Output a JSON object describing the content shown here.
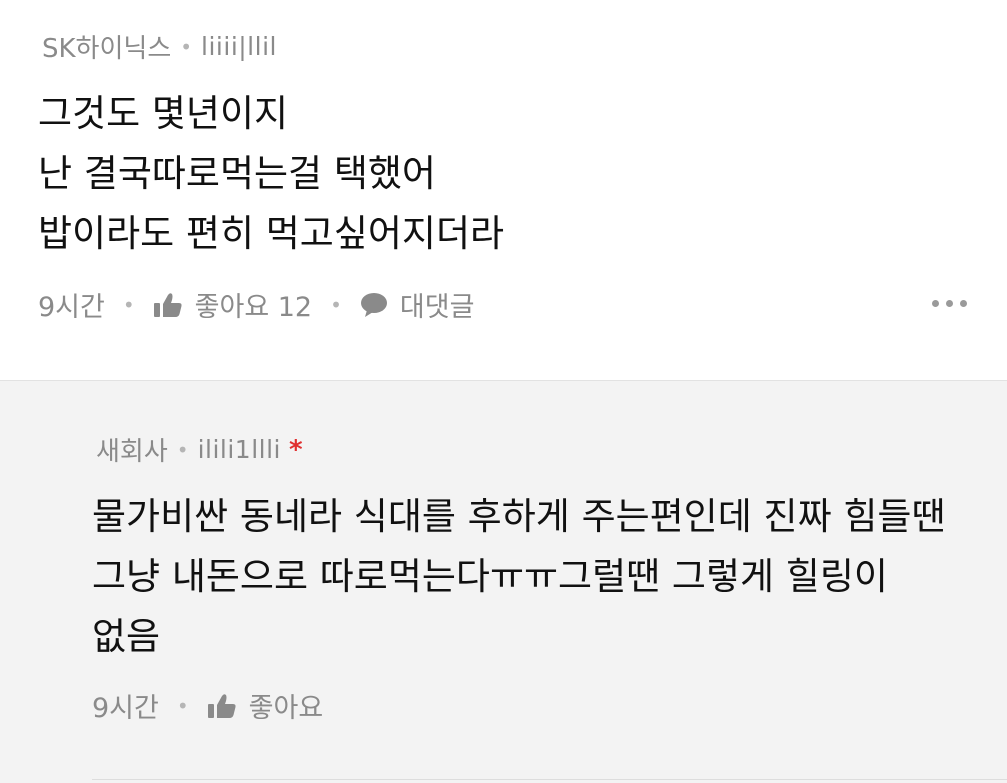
{
  "comment": {
    "author": "SK하이닉스",
    "nickname": "liiii|llil",
    "lines": [
      "그것도 몇년이지",
      "난 결국따로먹는걸 택했어",
      "밥이라도 편히 먹고싶어지더라"
    ],
    "time": "9시간",
    "like_label": "좋아요 12",
    "reply_label": "대댓글"
  },
  "reply": {
    "author": "새회사",
    "nickname": "ilili1llli",
    "marker": "*",
    "lines": [
      "물가비싼 동네라 식대를 후하게 주는편인데 진짜 힘들땐",
      "그냥 내돈으로 따로먹는다ㅠㅠ그럴땐 그렇게 힐링이",
      "없음"
    ],
    "time": "9시간",
    "like_label": "좋아요"
  },
  "colors": {
    "meta_gray": "#8a8a8a",
    "body_text": "#111111",
    "reply_bg": "#f3f3f3",
    "op_marker": "#e03030"
  }
}
